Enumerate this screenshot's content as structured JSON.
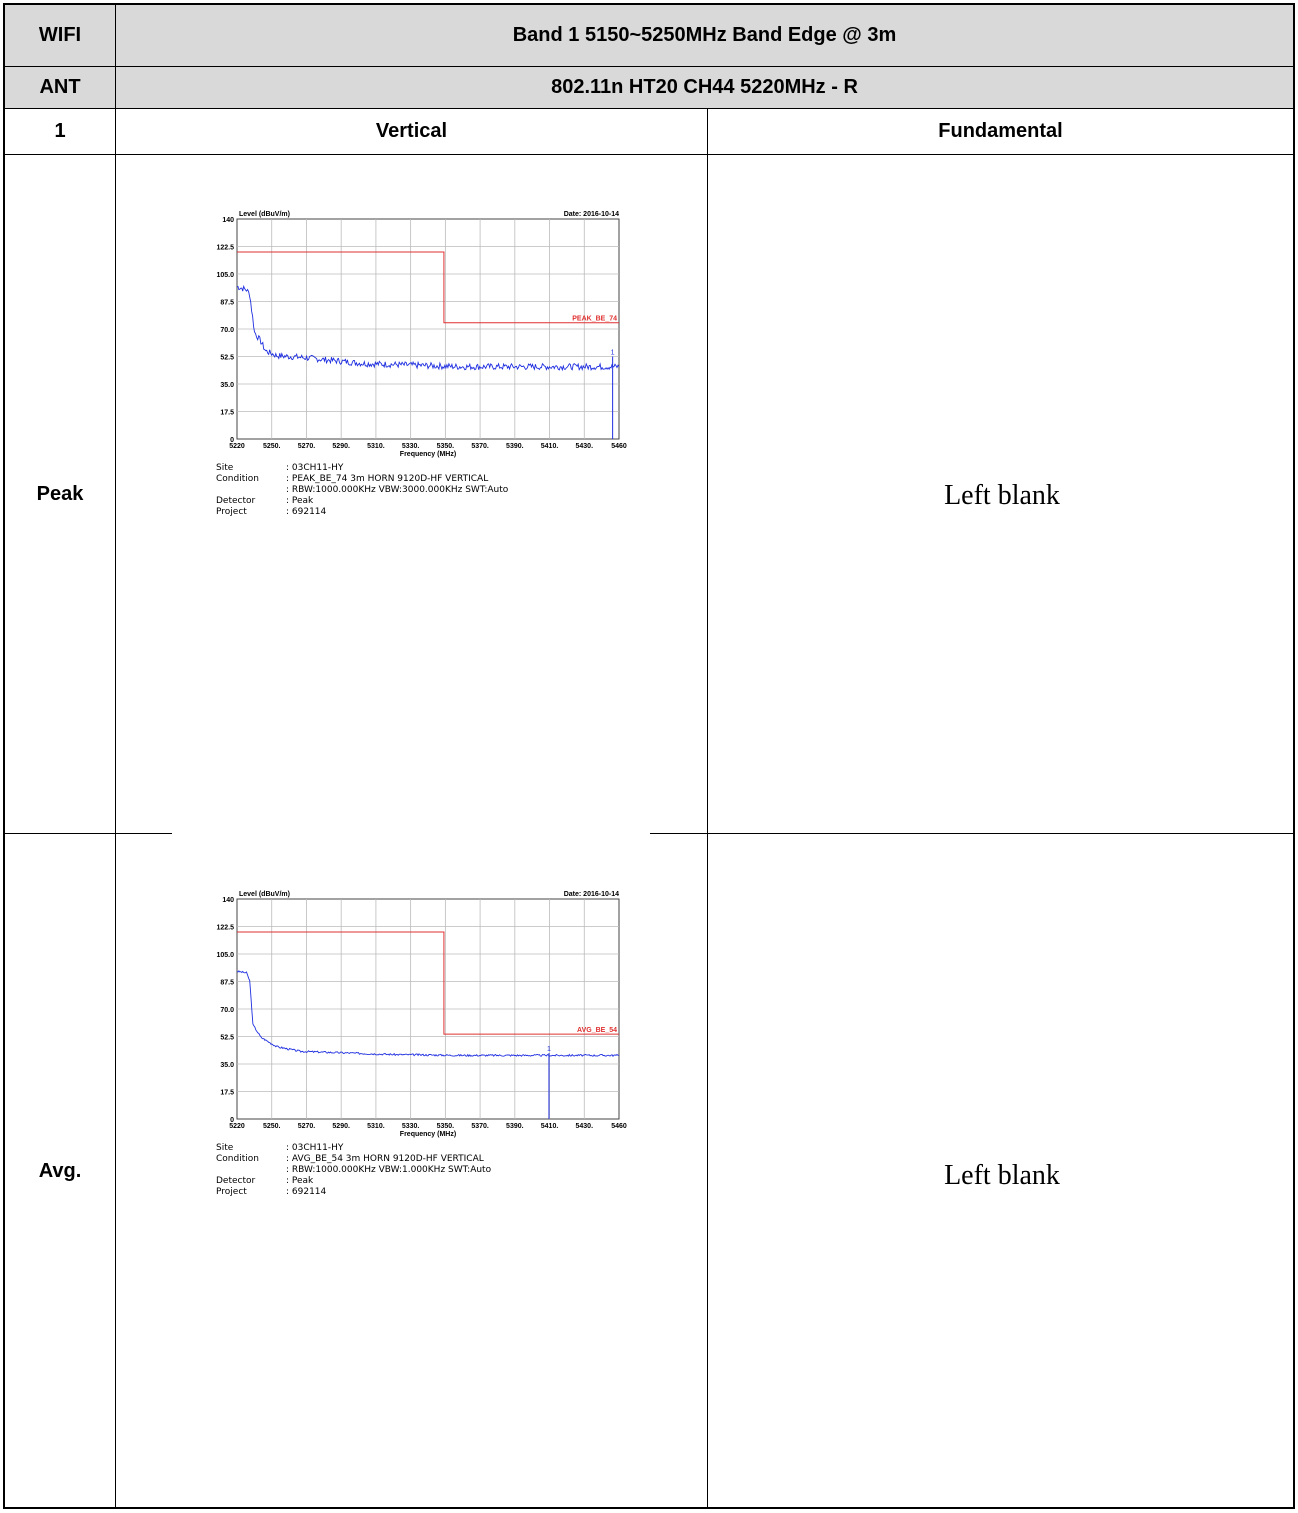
{
  "header": {
    "r1_left": "WIFI",
    "r1_right": "Band 1 5150~5250MHz Band Edge @ 3m",
    "r2_left": "ANT",
    "r2_right": "802.11n HT20 CH44 5220MHz - R",
    "r3_left": "1",
    "r3_mid": "Vertical",
    "r3_right": "Fundamental"
  },
  "rows": [
    {
      "label": "Peak",
      "right_text": "Left blank"
    },
    {
      "label": "Avg.",
      "right_text": "Left blank"
    }
  ],
  "chart_data": [
    {
      "type": "line",
      "ylabel": "Level (dBuV/m)",
      "date": "Date: 2016-10-14",
      "xlabel": "Frequency (MHz)",
      "xlim": [
        5220,
        5460
      ],
      "ylim": [
        0,
        140
      ],
      "x_tick_labels": [
        "5220",
        "5250.",
        "5270.",
        "5290.",
        "5310.",
        "5330.",
        "5350.",
        "5370.",
        "5390.",
        "5410.",
        "5430.",
        "5460"
      ],
      "y_tick_labels": [
        "0",
        "17.5",
        "35.0",
        "52.5",
        "70.0",
        "87.5",
        "105.0",
        "122.5",
        "140"
      ],
      "limit_label": "PEAK_BE_74",
      "limit_line": [
        {
          "x": 5220,
          "y": 119
        },
        {
          "x": 5350,
          "y": 119
        },
        {
          "x": 5350,
          "y": 74
        },
        {
          "x": 5460,
          "y": 74
        }
      ],
      "trace": [
        {
          "x": 5220,
          "y": 97
        },
        {
          "x": 5226,
          "y": 95
        },
        {
          "x": 5228,
          "y": 92
        },
        {
          "x": 5231,
          "y": 68
        },
        {
          "x": 5235,
          "y": 62
        },
        {
          "x": 5238,
          "y": 56
        },
        {
          "x": 5245,
          "y": 53
        },
        {
          "x": 5260,
          "y": 52
        },
        {
          "x": 5280,
          "y": 50
        },
        {
          "x": 5300,
          "y": 48
        },
        {
          "x": 5330,
          "y": 47
        },
        {
          "x": 5360,
          "y": 46
        },
        {
          "x": 5400,
          "y": 46
        },
        {
          "x": 5440,
          "y": 46
        },
        {
          "x": 5460,
          "y": 46
        }
      ],
      "marker": {
        "label": "1",
        "x": 5456,
        "y": 52.5
      },
      "grid": true,
      "info": {
        "site_k": "Site",
        "site_v": ": 03CH11-HY",
        "condition_k": "Condition",
        "condition_v": ": PEAK_BE_74 3m HORN 9120D-HF VERTICAL",
        "condition_v2": ": RBW:1000.000KHz VBW:3000.000KHz SWT:Auto",
        "detector_k": "Detector",
        "detector_v": ": Peak",
        "project_k": "Project",
        "project_v": ": 692114"
      }
    },
    {
      "type": "line",
      "ylabel": "Level (dBuV/m)",
      "date": "Date: 2016-10-14",
      "xlabel": "Frequency (MHz)",
      "xlim": [
        5220,
        5460
      ],
      "ylim": [
        0,
        140
      ],
      "x_tick_labels": [
        "5220",
        "5250.",
        "5270.",
        "5290.",
        "5310.",
        "5330.",
        "5350.",
        "5370.",
        "5390.",
        "5410.",
        "5430.",
        "5460"
      ],
      "y_tick_labels": [
        "0",
        "17.5",
        "35.0",
        "52.5",
        "70.0",
        "87.5",
        "105.0",
        "122.5",
        "140"
      ],
      "limit_label": "AVG_BE_54",
      "limit_line": [
        {
          "x": 5220,
          "y": 119
        },
        {
          "x": 5350,
          "y": 119
        },
        {
          "x": 5350,
          "y": 54
        },
        {
          "x": 5460,
          "y": 54
        }
      ],
      "trace": [
        {
          "x": 5220,
          "y": 94
        },
        {
          "x": 5226,
          "y": 93
        },
        {
          "x": 5228,
          "y": 88
        },
        {
          "x": 5230,
          "y": 60
        },
        {
          "x": 5235,
          "y": 52
        },
        {
          "x": 5245,
          "y": 46
        },
        {
          "x": 5260,
          "y": 43
        },
        {
          "x": 5290,
          "y": 42
        },
        {
          "x": 5320,
          "y": 41
        },
        {
          "x": 5360,
          "y": 40.5
        },
        {
          "x": 5400,
          "y": 40.5
        },
        {
          "x": 5430,
          "y": 40.5
        },
        {
          "x": 5460,
          "y": 40.5
        }
      ],
      "marker": {
        "label": "1",
        "x": 5416,
        "y": 42
      },
      "grid": true,
      "info": {
        "site_k": "Site",
        "site_v": ": 03CH11-HY",
        "condition_k": "Condition",
        "condition_v": ": AVG_BE_54 3m HORN 9120D-HF VERTICAL",
        "condition_v2": ": RBW:1000.000KHz VBW:1.000KHz SWT:Auto",
        "detector_k": "Detector",
        "detector_v": ": Peak",
        "project_k": "Project",
        "project_v": ": 692114"
      }
    }
  ]
}
